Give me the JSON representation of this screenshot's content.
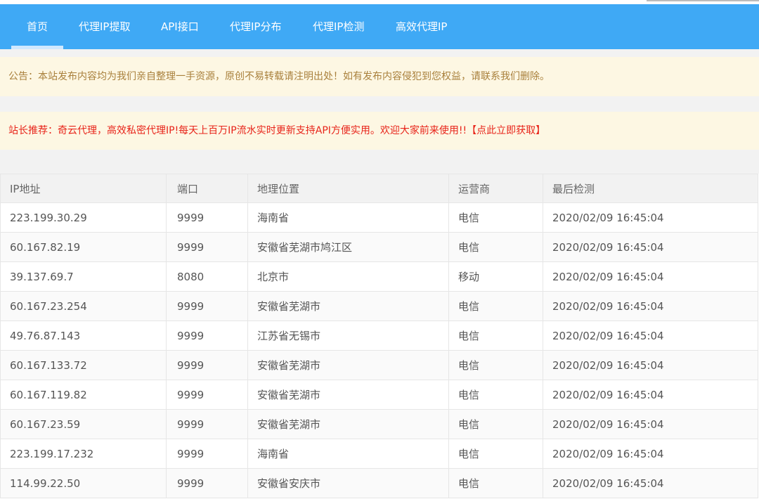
{
  "nav": {
    "items": [
      {
        "label": "首页",
        "active": true
      },
      {
        "label": "代理IP提取",
        "active": false
      },
      {
        "label": "API接口",
        "active": false
      },
      {
        "label": "代理IP分布",
        "active": false
      },
      {
        "label": "代理IP检测",
        "active": false
      },
      {
        "label": "高效代理IP",
        "active": false
      }
    ]
  },
  "announcement": {
    "text": "公告：本站发布内容均为我们亲自整理一手资源，原创不易转载请注明出处！如有发布内容侵犯到您权益，请联系我们删除。"
  },
  "recommendation": {
    "text": "站长推荐：奇云代理，高效私密代理IP!每天上百万IP流水实时更新支持API方便实用。欢迎大家前来使用!!",
    "link_label": "【点此立即获取】"
  },
  "table": {
    "headers": [
      "IP地址",
      "端口",
      "地理位置",
      "运营商",
      "最后检测"
    ],
    "rows": [
      [
        "223.199.30.29",
        "9999",
        "海南省",
        "电信",
        "2020/02/09 16:45:04"
      ],
      [
        "60.167.82.19",
        "9999",
        "安徽省芜湖市鸠江区",
        "电信",
        "2020/02/09 16:45:04"
      ],
      [
        "39.137.69.7",
        "8080",
        "北京市",
        "移动",
        "2020/02/09 16:45:04"
      ],
      [
        "60.167.23.254",
        "9999",
        "安徽省芜湖市",
        "电信",
        "2020/02/09 16:45:04"
      ],
      [
        "49.76.87.143",
        "9999",
        "江苏省无锡市",
        "电信",
        "2020/02/09 16:45:04"
      ],
      [
        "60.167.133.72",
        "9999",
        "安徽省芜湖市",
        "电信",
        "2020/02/09 16:45:04"
      ],
      [
        "60.167.119.82",
        "9999",
        "安徽省芜湖市",
        "电信",
        "2020/02/09 16:45:04"
      ],
      [
        "60.167.23.59",
        "9999",
        "安徽省芜湖市",
        "电信",
        "2020/02/09 16:45:04"
      ],
      [
        "223.199.17.232",
        "9999",
        "海南省",
        "电信",
        "2020/02/09 16:45:04"
      ],
      [
        "114.99.22.50",
        "9999",
        "安徽省安庆市",
        "电信",
        "2020/02/09 16:45:04"
      ]
    ]
  },
  "colors": {
    "navbar": "#3fa9f5",
    "announcement_text": "#a9803c",
    "recommendation_text": "#e8241a",
    "notice_background": "#fdf7e3"
  }
}
